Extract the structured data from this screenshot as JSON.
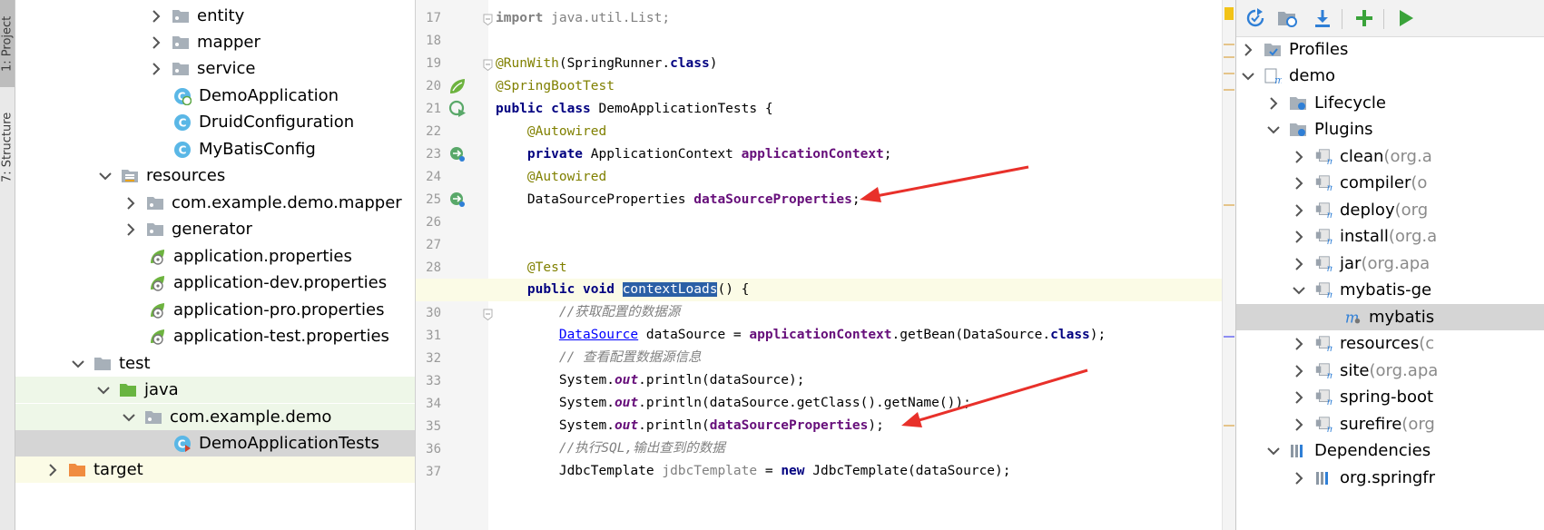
{
  "side_strip": {
    "project_tab": "1: Project",
    "structure_tab": "7: Structure"
  },
  "project_tree": {
    "items": [
      {
        "label": "entity",
        "type": "package",
        "expanded": false
      },
      {
        "label": "mapper",
        "type": "package",
        "expanded": false
      },
      {
        "label": "service",
        "type": "package",
        "expanded": false
      },
      {
        "label": "DemoApplication",
        "type": "spring-class"
      },
      {
        "label": "DruidConfiguration",
        "type": "class"
      },
      {
        "label": "MyBatisConfig",
        "type": "class"
      },
      {
        "label": "resources",
        "type": "resources-folder",
        "expanded": true
      },
      {
        "label": "com.example.demo.mapper",
        "type": "package",
        "expanded": false
      },
      {
        "label": "generator",
        "type": "package",
        "expanded": false
      },
      {
        "label": "application.properties",
        "type": "spring-properties"
      },
      {
        "label": "application-dev.properties",
        "type": "spring-properties"
      },
      {
        "label": "application-pro.properties",
        "type": "spring-properties"
      },
      {
        "label": "application-test.properties",
        "type": "spring-properties"
      },
      {
        "label": "test",
        "type": "folder",
        "expanded": true
      },
      {
        "label": "java",
        "type": "test-source-folder",
        "expanded": true
      },
      {
        "label": "com.example.demo",
        "type": "package",
        "expanded": true
      },
      {
        "label": "DemoApplicationTests",
        "type": "test-class",
        "selected": true
      },
      {
        "label": "target",
        "type": "excluded-folder",
        "expanded": false
      }
    ]
  },
  "editor": {
    "line_numbers": [
      "17",
      "18",
      "19",
      "20",
      "21",
      "22",
      "23",
      "24",
      "25",
      "26",
      "27",
      "28",
      "29",
      "30",
      "31",
      "32",
      "33",
      "34",
      "35",
      "36",
      "37"
    ],
    "lines": {
      "l17": {
        "kw": "import",
        "rest": " java.util.List;"
      },
      "l19": {
        "ann": "@RunWith",
        "a": "(SpringRunner.",
        "kw": "class",
        "b": ")"
      },
      "l20": {
        "ann": "@SpringBootTest"
      },
      "l21": {
        "kw1": "public",
        "kw2": "class",
        "rest": " DemoApplicationTests {"
      },
      "l22": {
        "ann": "@Autowired"
      },
      "l23": {
        "kw": "private",
        "type": " ApplicationContext ",
        "field": "applicationContext",
        "end": ";"
      },
      "l24": {
        "ann": "@Autowired"
      },
      "l25": {
        "type": "DataSourceProperties ",
        "field": "dataSourceProperties",
        "end": ";"
      },
      "l28": {
        "ann": "@Test"
      },
      "l29": {
        "kw1": "public",
        "kw2": "void",
        "method": "contextLoads",
        "end": "() {"
      },
      "l30": {
        "comment": "//获取配置的数据源"
      },
      "l31": {
        "link": "DataSource",
        "a": " dataSource = ",
        "field": "applicationContext",
        "b": ".getBean(DataSource.",
        "kw": "class",
        "c": ");"
      },
      "l32": {
        "comment": "// 查看配置数据源信息"
      },
      "l33": {
        "a": "System.",
        "st": "out",
        "b": ".println(dataSource);"
      },
      "l34": {
        "a": "System.",
        "st": "out",
        "b": ".println(dataSource.getClass().getName());"
      },
      "l35": {
        "a": "System.",
        "st": "out",
        "b": ".println(",
        "field": "dataSourceProperties",
        "c": ");"
      },
      "l36": {
        "comment": "//执行SQL,输出查到的数据"
      },
      "l37": {
        "a": "JdbcTemplate ",
        "var": "jdbcTemplate",
        "b": " = ",
        "kw": "new",
        "c": " JdbcTemplate(dataSource);"
      }
    }
  },
  "maven": {
    "toolbar": [
      "reload-icon",
      "generate-sources-icon",
      "download-icon",
      "add-icon",
      "run-icon"
    ],
    "items": [
      {
        "label": "Profiles",
        "dim": "",
        "type": "profiles"
      },
      {
        "label": "demo",
        "dim": "",
        "type": "maven-project"
      },
      {
        "label": "Lifecycle",
        "dim": "",
        "type": "lifecycle"
      },
      {
        "label": "Plugins",
        "dim": "",
        "type": "plugins"
      },
      {
        "label": "clean",
        "dim": " (org.a",
        "type": "plugin"
      },
      {
        "label": "compiler",
        "dim": " (o",
        "type": "plugin"
      },
      {
        "label": "deploy",
        "dim": " (org",
        "type": "plugin"
      },
      {
        "label": "install",
        "dim": " (org.a",
        "type": "plugin"
      },
      {
        "label": "jar",
        "dim": " (org.apa",
        "type": "plugin"
      },
      {
        "label": "mybatis-ge",
        "dim": "",
        "type": "plugin"
      },
      {
        "label": "mybatis",
        "dim": "",
        "type": "goal"
      },
      {
        "label": "resources",
        "dim": " (c",
        "type": "plugin"
      },
      {
        "label": "site",
        "dim": " (org.apa",
        "type": "plugin"
      },
      {
        "label": "spring-boot",
        "dim": "",
        "type": "plugin"
      },
      {
        "label": "surefire",
        "dim": " (org",
        "type": "plugin"
      },
      {
        "label": "Dependencies",
        "dim": "",
        "type": "dependencies"
      },
      {
        "label": "org.springfr",
        "dim": "",
        "type": "library"
      }
    ]
  },
  "colors": {
    "keyword": "#000080",
    "annotation": "#808000",
    "field": "#660e7a",
    "comment": "#808080",
    "arrow": "#e8302a"
  }
}
